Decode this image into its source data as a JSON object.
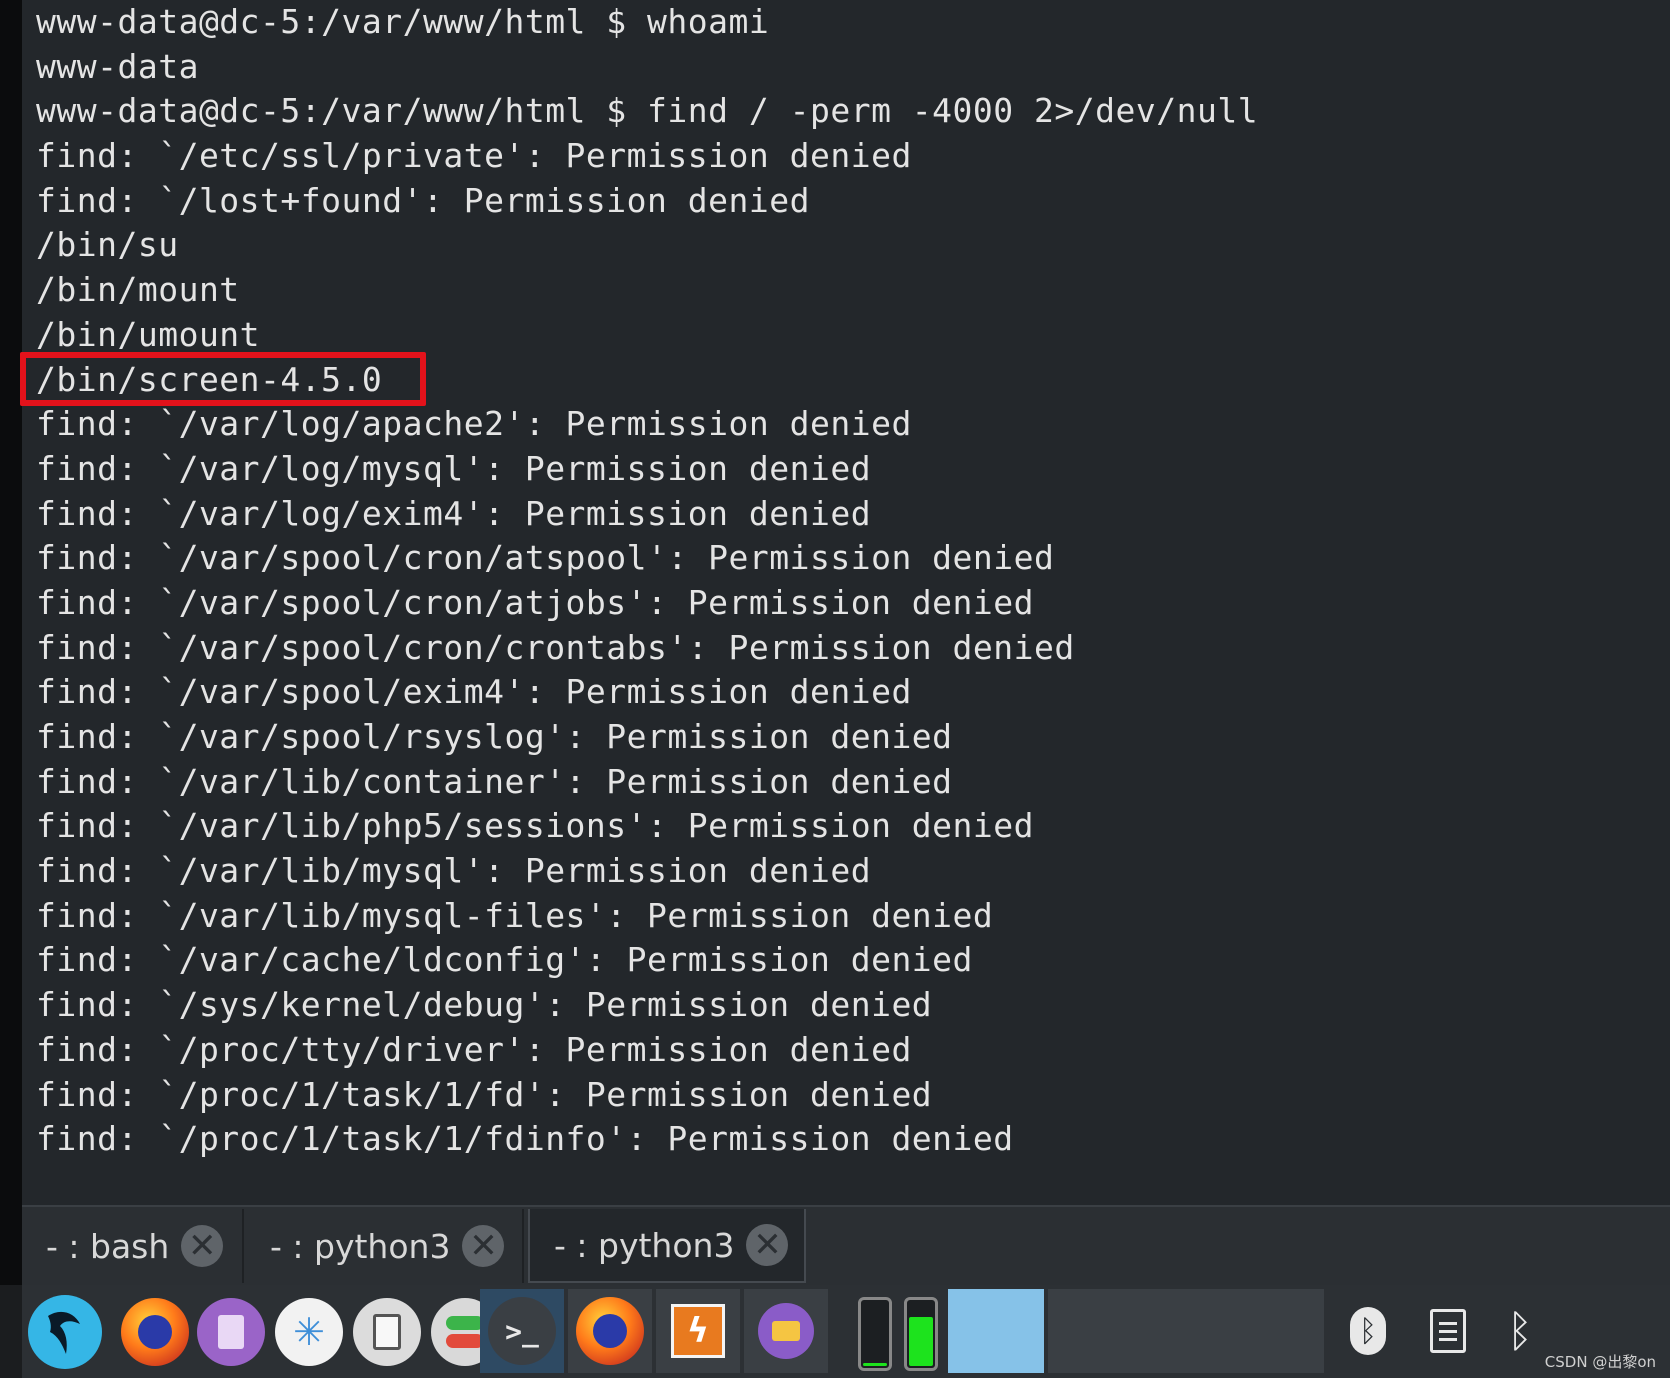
{
  "terminal": {
    "lines": [
      "www-data@dc-5:/var/www/html $ whoami",
      "www-data",
      "www-data@dc-5:/var/www/html $ find / -perm -4000 2>/dev/null",
      "find: `/etc/ssl/private': Permission denied",
      "find: `/lost+found': Permission denied",
      "/bin/su",
      "/bin/mount",
      "/bin/umount",
      "/bin/screen-4.5.0",
      "find: `/var/log/apache2': Permission denied",
      "find: `/var/log/mysql': Permission denied",
      "find: `/var/log/exim4': Permission denied",
      "find: `/var/spool/cron/atspool': Permission denied",
      "find: `/var/spool/cron/atjobs': Permission denied",
      "find: `/var/spool/cron/crontabs': Permission denied",
      "find: `/var/spool/exim4': Permission denied",
      "find: `/var/spool/rsyslog': Permission denied",
      "find: `/var/lib/container': Permission denied",
      "find: `/var/lib/php5/sessions': Permission denied",
      "find: `/var/lib/mysql': Permission denied",
      "find: `/var/lib/mysql-files': Permission denied",
      "find: `/var/cache/ldconfig': Permission denied",
      "find: `/sys/kernel/debug': Permission denied",
      "find: `/proc/tty/driver': Permission denied",
      "find: `/proc/1/task/1/fd': Permission denied",
      "find: `/proc/1/task/1/fdinfo': Permission denied"
    ],
    "highlighted_line": "/bin/screen-4.5.0"
  },
  "tabs": [
    {
      "label": "- : bash",
      "close": "✕"
    },
    {
      "label": "- : python3",
      "close": "✕"
    },
    {
      "label": "- : python3",
      "close": "✕",
      "active": true
    }
  ],
  "taskbar": {
    "launchers": [
      "kali-menu-icon",
      "firefox-icon",
      "text-editor-icon",
      "network-icon",
      "files-icon",
      "settings-toggle-icon",
      "terminal-icon",
      "firefox-window-icon",
      "burp-icon",
      "file-manager-icon"
    ],
    "cpu_meter_level": 0.05,
    "memory_meter_level": 0.72,
    "workspace_count": 4,
    "current_workspace": 1,
    "tray": [
      "bluetooth-icon",
      "clipboard-icon",
      "bluetooth-symbol-icon"
    ],
    "colors": {
      "kali": "#35b6e6",
      "firefox": "#ff6a1a",
      "memory": "#1de31d",
      "workspace_current": "#86c2e8",
      "highlight": "#e3121b"
    }
  },
  "watermark": "CSDN @出黎on"
}
